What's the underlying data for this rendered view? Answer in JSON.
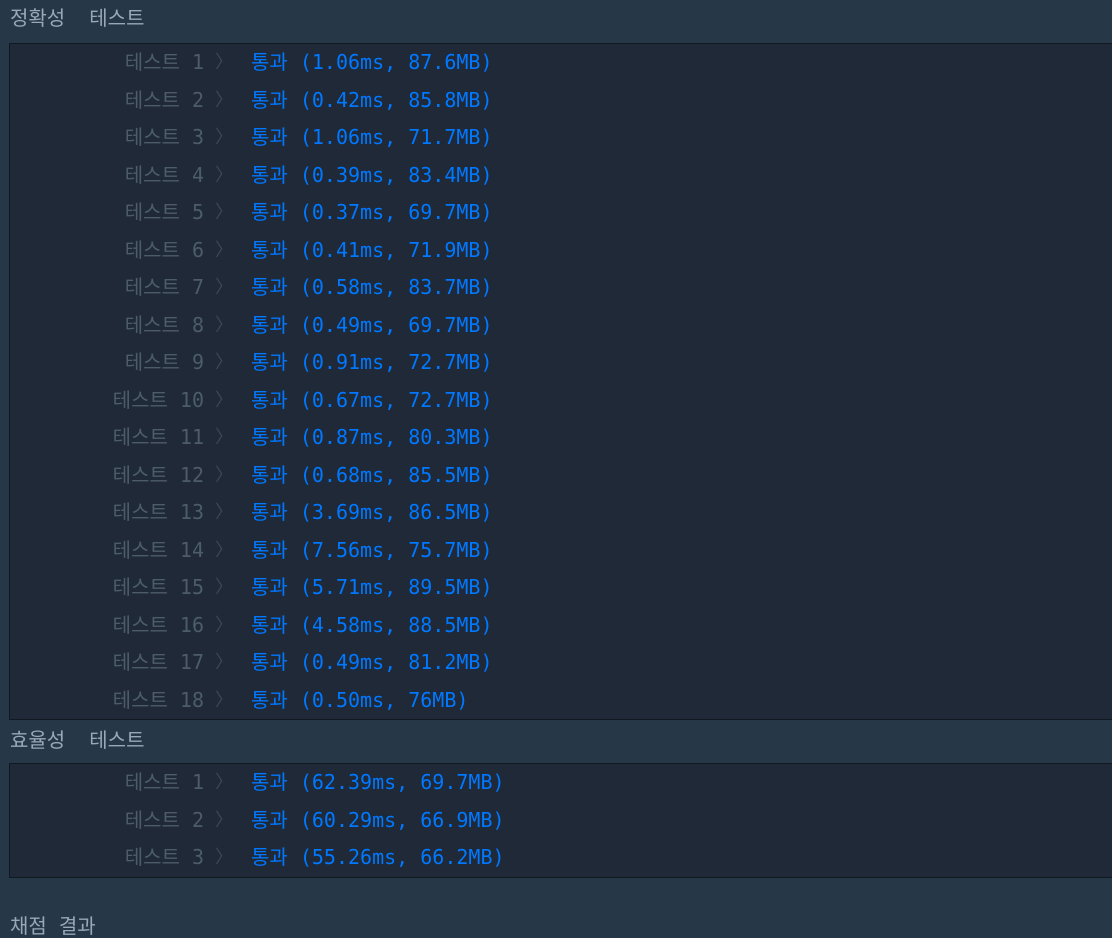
{
  "sections": [
    {
      "title": "정확성  테스트",
      "tests": [
        {
          "label": "테스트 1",
          "result": "통과 (1.06ms, 87.6MB)"
        },
        {
          "label": "테스트 2",
          "result": "통과 (0.42ms, 85.8MB)"
        },
        {
          "label": "테스트 3",
          "result": "통과 (1.06ms, 71.7MB)"
        },
        {
          "label": "테스트 4",
          "result": "통과 (0.39ms, 83.4MB)"
        },
        {
          "label": "테스트 5",
          "result": "통과 (0.37ms, 69.7MB)"
        },
        {
          "label": "테스트 6",
          "result": "통과 (0.41ms, 71.9MB)"
        },
        {
          "label": "테스트 7",
          "result": "통과 (0.58ms, 83.7MB)"
        },
        {
          "label": "테스트 8",
          "result": "통과 (0.49ms, 69.7MB)"
        },
        {
          "label": "테스트 9",
          "result": "통과 (0.91ms, 72.7MB)"
        },
        {
          "label": "테스트 10",
          "result": "통과 (0.67ms, 72.7MB)"
        },
        {
          "label": "테스트 11",
          "result": "통과 (0.87ms, 80.3MB)"
        },
        {
          "label": "테스트 12",
          "result": "통과 (0.68ms, 85.5MB)"
        },
        {
          "label": "테스트 13",
          "result": "통과 (3.69ms, 86.5MB)"
        },
        {
          "label": "테스트 14",
          "result": "통과 (7.56ms, 75.7MB)"
        },
        {
          "label": "테스트 15",
          "result": "통과 (5.71ms, 89.5MB)"
        },
        {
          "label": "테스트 16",
          "result": "통과 (4.58ms, 88.5MB)"
        },
        {
          "label": "테스트 17",
          "result": "통과 (0.49ms, 81.2MB)"
        },
        {
          "label": "테스트 18",
          "result": "통과 (0.50ms, 76MB)"
        }
      ]
    },
    {
      "title": "효율성  테스트",
      "tests": [
        {
          "label": "테스트 1",
          "result": "통과 (62.39ms, 69.7MB)"
        },
        {
          "label": "테스트 2",
          "result": "통과 (60.29ms, 66.9MB)"
        },
        {
          "label": "테스트 3",
          "result": "통과 (55.26ms, 66.2MB)"
        }
      ]
    }
  ],
  "grading": {
    "title": "채점 결과"
  },
  "chevron": "〉",
  "colors": {
    "background": "#263747",
    "panel": "#1f2937",
    "pass": "#0078ff",
    "label": "#4c5c6b",
    "section_title": "#98a8b9"
  }
}
